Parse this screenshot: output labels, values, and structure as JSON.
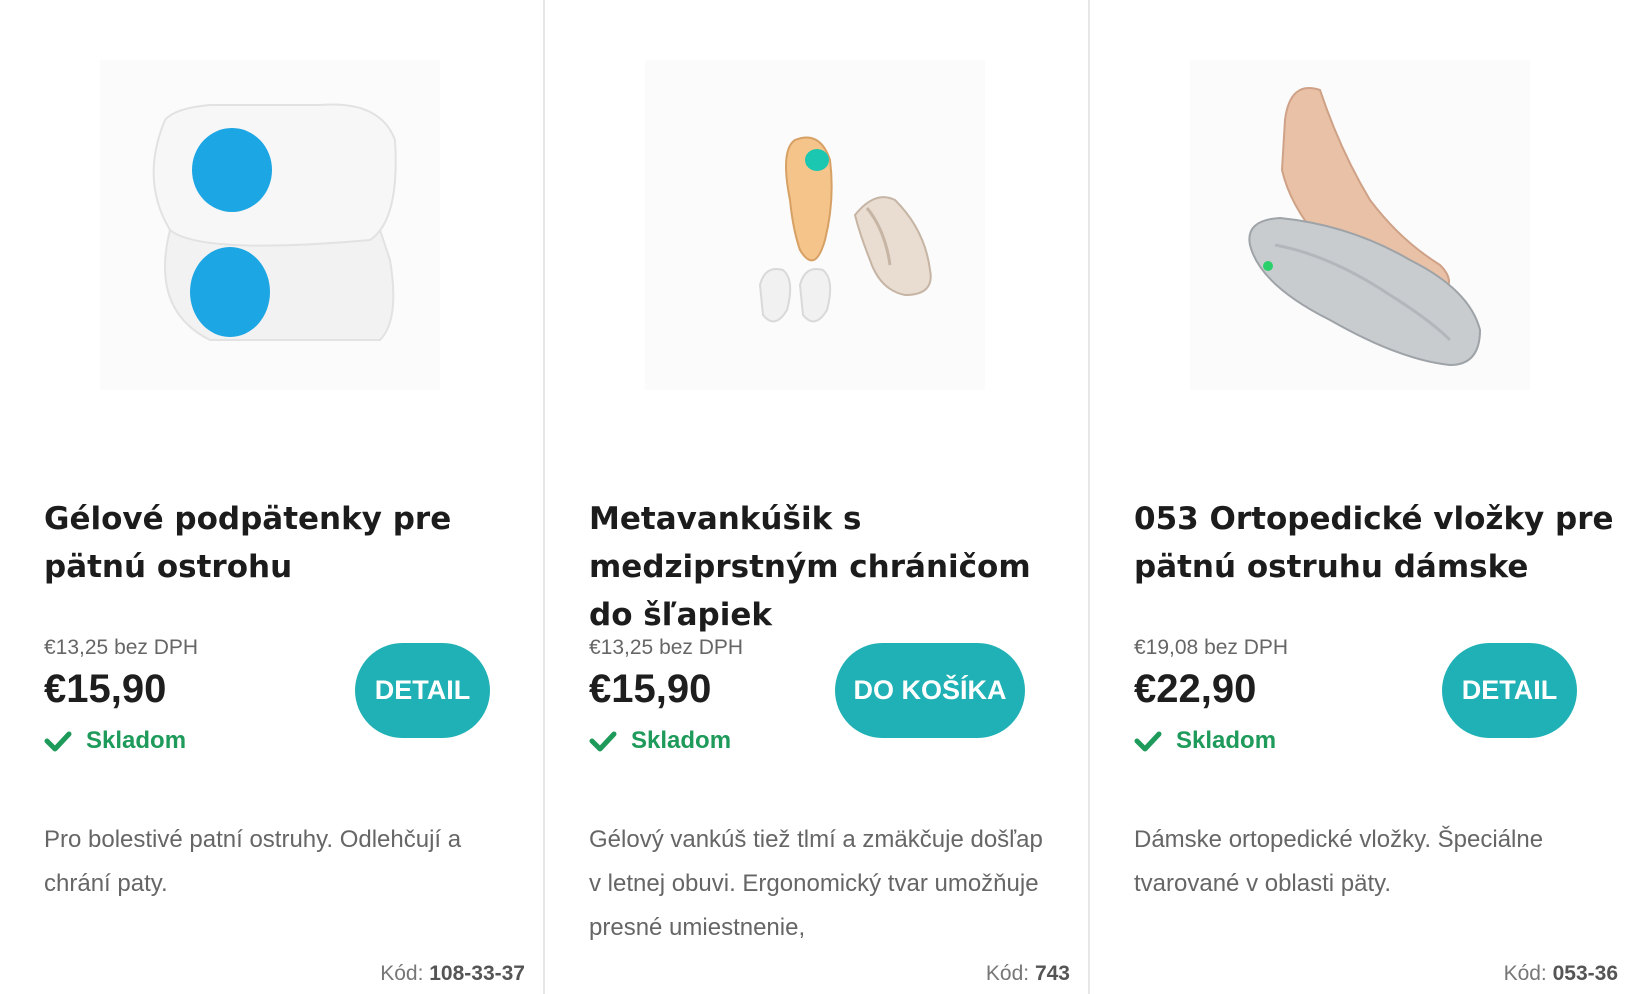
{
  "products": [
    {
      "title": "Gélové podpätenky pre pätnú ostrohu",
      "net_price": "€13,25 bez DPH",
      "price": "€15,90",
      "stock": "Skladom",
      "button": "DETAIL",
      "description": "Pro bolestivé patní ostruhy. Odlehčují a chrání paty.",
      "code_label": "Kód:",
      "code_value": "108-33-37"
    },
    {
      "title": "Metavankúšik s medziprstným chráničom do šľapiek",
      "net_price": "€13,25 bez DPH",
      "price": "€15,90",
      "stock": "Skladom",
      "button": "DO KOŠÍKA",
      "description": "Gélový vankúš tiež tlmí a zmäkčuje došľap v letnej obuvi. Ergonomický tvar umožňuje presné umiestnenie,",
      "code_label": "Kód:",
      "code_value": "743"
    },
    {
      "title": "053 Ortopedické vložky pre pätnú ostruhu dámske",
      "net_price": "€19,08 bez DPH",
      "price": "€22,90",
      "stock": "Skladom",
      "button": "DETAIL",
      "description": "Dámske ortopedické vložky. Špeciálne tvarované v oblasti päty.",
      "code_label": "Kód:",
      "code_value": "053-36"
    }
  ],
  "colors": {
    "accent": "#1fb1b5",
    "stock_green": "#1e9a5a",
    "gel_blue": "#1da6e4"
  },
  "icons": {
    "stock": "check-icon"
  }
}
